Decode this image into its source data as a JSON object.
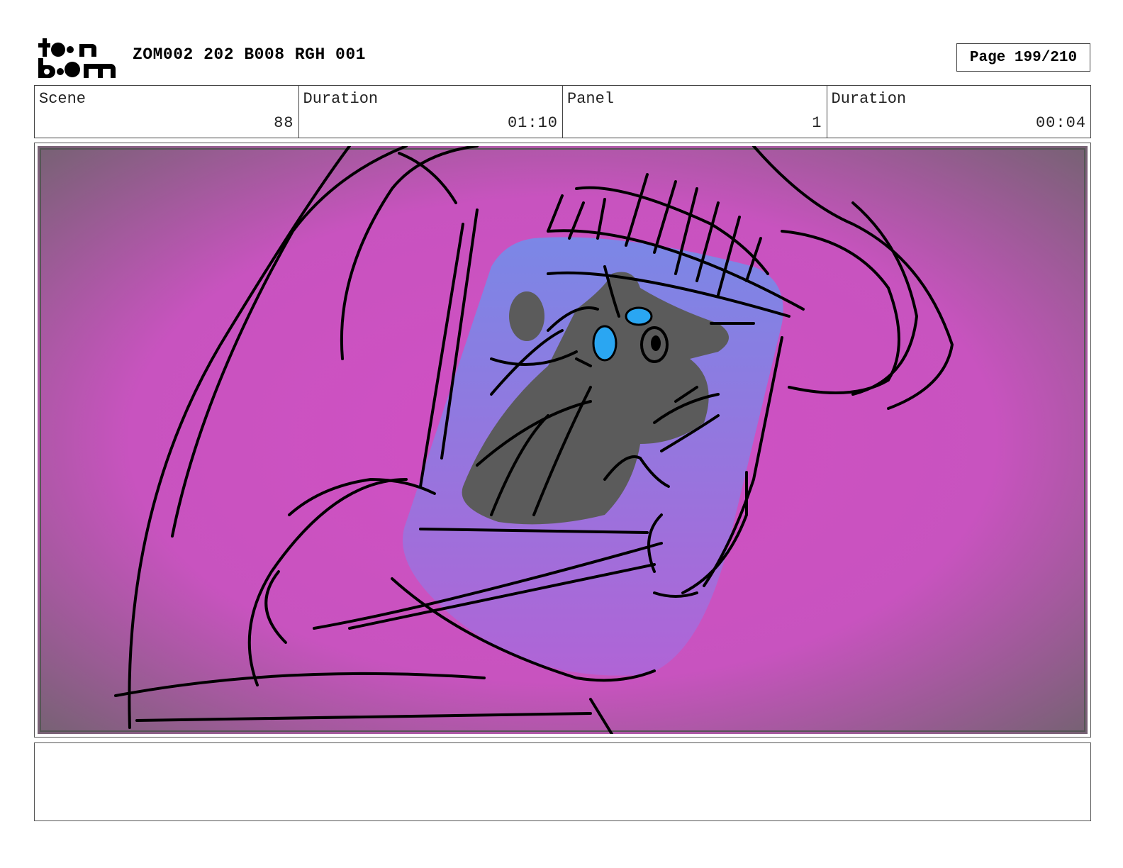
{
  "header": {
    "logo_text": "toon boom",
    "document_title": "ZOM002 202 B008 RGH 001",
    "page_label": "Page 199/210"
  },
  "info": {
    "scene_label": "Scene",
    "scene_value": "88",
    "scene_duration_label": "Duration",
    "scene_duration_value": "01:10",
    "panel_label": "Panel",
    "panel_value": "1",
    "panel_duration_label": "Duration",
    "panel_duration_value": "00:04"
  },
  "panel": {
    "colors": {
      "background_center": "#d14fc4",
      "background_edge": "#6a6468",
      "phone_top": "#7b87e6",
      "phone_bottom": "#b064d6",
      "creature": "#5b5b5b",
      "eye": "#2aa6f2"
    }
  },
  "notes": {
    "text": ""
  }
}
